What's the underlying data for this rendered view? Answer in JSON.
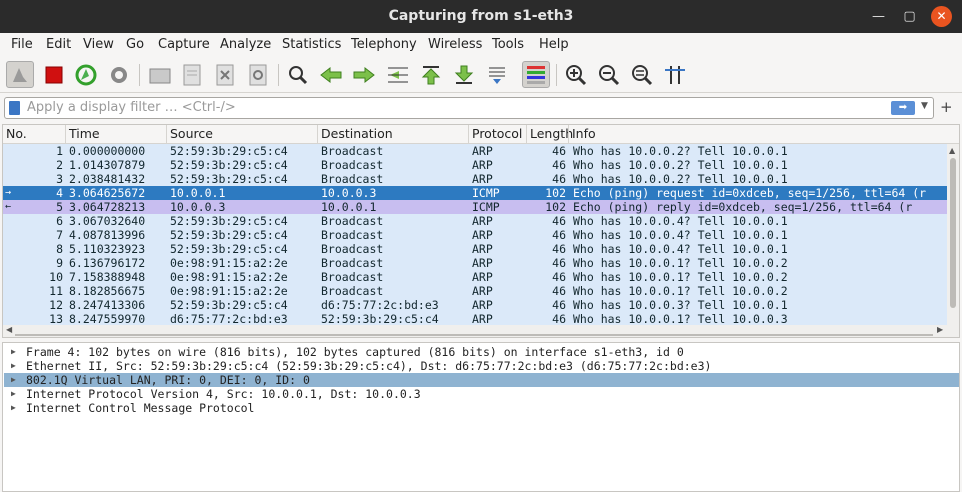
{
  "window": {
    "title": "Capturing from s1-eth3"
  },
  "menu": [
    "File",
    "Edit",
    "View",
    "Go",
    "Capture",
    "Analyze",
    "Statistics",
    "Telephony",
    "Wireless",
    "Tools",
    "Help"
  ],
  "filter": {
    "placeholder": "Apply a display filter … <Ctrl-/>"
  },
  "columns": [
    "No.",
    "Time",
    "Source",
    "Destination",
    "Protocol",
    "Length",
    "Info"
  ],
  "packets": [
    {
      "no": "1",
      "time": "0.000000000",
      "src": "52:59:3b:29:c5:c4",
      "dst": "Broadcast",
      "proto": "ARP",
      "len": "46",
      "info": "Who has 10.0.0.2? Tell 10.0.0.1"
    },
    {
      "no": "2",
      "time": "1.014307879",
      "src": "52:59:3b:29:c5:c4",
      "dst": "Broadcast",
      "proto": "ARP",
      "len": "46",
      "info": "Who has 10.0.0.2? Tell 10.0.0.1"
    },
    {
      "no": "3",
      "time": "2.038481432",
      "src": "52:59:3b:29:c5:c4",
      "dst": "Broadcast",
      "proto": "ARP",
      "len": "46",
      "info": "Who has 10.0.0.2? Tell 10.0.0.1"
    },
    {
      "no": "4",
      "time": "3.064625672",
      "src": "10.0.0.1",
      "dst": "10.0.0.3",
      "proto": "ICMP",
      "len": "102",
      "info": "Echo (ping) request  id=0xdceb, seq=1/256, ttl=64 (r"
    },
    {
      "no": "5",
      "time": "3.064728213",
      "src": "10.0.0.3",
      "dst": "10.0.0.1",
      "proto": "ICMP",
      "len": "102",
      "info": "Echo (ping) reply    id=0xdceb, seq=1/256, ttl=64 (r"
    },
    {
      "no": "6",
      "time": "3.067032640",
      "src": "52:59:3b:29:c5:c4",
      "dst": "Broadcast",
      "proto": "ARP",
      "len": "46",
      "info": "Who has 10.0.0.4? Tell 10.0.0.1"
    },
    {
      "no": "7",
      "time": "4.087813996",
      "src": "52:59:3b:29:c5:c4",
      "dst": "Broadcast",
      "proto": "ARP",
      "len": "46",
      "info": "Who has 10.0.0.4? Tell 10.0.0.1"
    },
    {
      "no": "8",
      "time": "5.110323923",
      "src": "52:59:3b:29:c5:c4",
      "dst": "Broadcast",
      "proto": "ARP",
      "len": "46",
      "info": "Who has 10.0.0.4? Tell 10.0.0.1"
    },
    {
      "no": "9",
      "time": "6.136796172",
      "src": "0e:98:91:15:a2:2e",
      "dst": "Broadcast",
      "proto": "ARP",
      "len": "46",
      "info": "Who has 10.0.0.1? Tell 10.0.0.2"
    },
    {
      "no": "10",
      "time": "7.158388948",
      "src": "0e:98:91:15:a2:2e",
      "dst": "Broadcast",
      "proto": "ARP",
      "len": "46",
      "info": "Who has 10.0.0.1? Tell 10.0.0.2"
    },
    {
      "no": "11",
      "time": "8.182856675",
      "src": "0e:98:91:15:a2:2e",
      "dst": "Broadcast",
      "proto": "ARP",
      "len": "46",
      "info": "Who has 10.0.0.1? Tell 10.0.0.2"
    },
    {
      "no": "12",
      "time": "8.247413306",
      "src": "52:59:3b:29:c5:c4",
      "dst": "d6:75:77:2c:bd:e3",
      "proto": "ARP",
      "len": "46",
      "info": "Who has 10.0.0.3? Tell 10.0.0.1"
    },
    {
      "no": "13",
      "time": "8.247559970",
      "src": "d6:75:77:2c:bd:e3",
      "dst": "52:59:3b:29:c5:c4",
      "proto": "ARP",
      "len": "46",
      "info": "Who has 10.0.0.1? Tell 10.0.0.3"
    }
  ],
  "selected_packet": "4",
  "details": [
    "Frame 4: 102 bytes on wire (816 bits), 102 bytes captured (816 bits) on interface s1-eth3, id 0",
    "Ethernet II, Src: 52:59:3b:29:c5:c4 (52:59:3b:29:c5:c4), Dst: d6:75:77:2c:bd:e3 (d6:75:77:2c:bd:e3)",
    "802.1Q Virtual LAN, PRI: 0, DEI: 0, ID: 0",
    "Internet Protocol Version 4, Src: 10.0.0.1, Dst: 10.0.0.3",
    "Internet Control Message Protocol"
  ],
  "colors": {
    "row_bg": "#dbe9f9",
    "row_icmp": "#c8bef0",
    "row_selected": "#2d7ac1",
    "detail_highlight": "#8fb3d1",
    "titlebar": "#2b2b2b",
    "close_button": "#e95420"
  },
  "toolbar_icons": [
    "shark-fin-start-icon",
    "stop-icon",
    "restart-icon",
    "options-gear-icon",
    "open-folder-icon",
    "save-file-icon",
    "close-file-icon",
    "reload-icon",
    "find-icon",
    "back-arrow-icon",
    "forward-arrow-icon",
    "goto-packet-icon",
    "first-packet-icon",
    "last-packet-icon",
    "autoscroll-icon",
    "colorize-icon",
    "zoom-in-icon",
    "zoom-out-icon",
    "zoom-normal-icon",
    "resize-columns-icon"
  ]
}
